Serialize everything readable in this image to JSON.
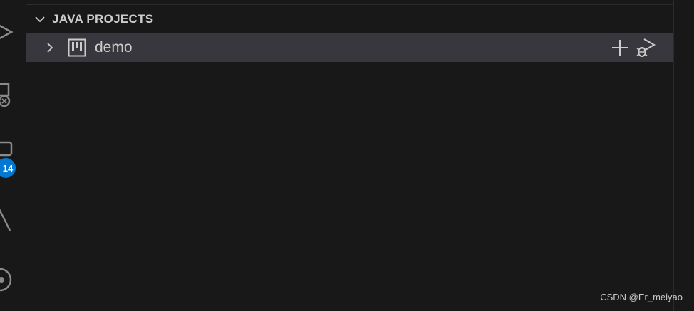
{
  "section": {
    "title": "JAVA PROJECTS",
    "expanded": true
  },
  "tree": {
    "items": [
      {
        "label": "demo",
        "expanded": false,
        "selected": true,
        "icon": "project-icon"
      }
    ]
  },
  "row_actions": {
    "new_icon": "plus-icon",
    "run_debug_icon": "debug-run-icon"
  },
  "activity_bar": {
    "icons": [
      "run-icon",
      "remote-explorer-icon",
      "source-control-icon",
      "testing-icon",
      "extension-icon"
    ],
    "badge": "14"
  },
  "watermark": "CSDN @Er_meiyao",
  "colors": {
    "background": "#181818",
    "row_selected": "#37373d",
    "badge": "#0078d4",
    "text": "#cccccc"
  }
}
